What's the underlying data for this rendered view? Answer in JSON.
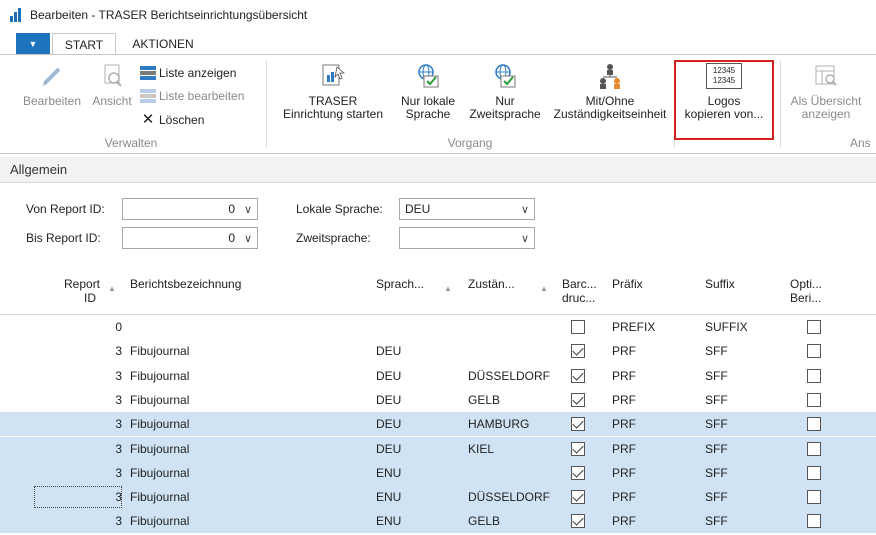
{
  "window": {
    "title": "Bearbeiten - TRASER Berichtseinrichtungsübersicht"
  },
  "tabs": [
    {
      "label": "START"
    },
    {
      "label": "AKTIONEN"
    }
  ],
  "ribbon": {
    "groups": {
      "verwalten": "Verwalten",
      "vorgang": "Vorgang",
      "ansicht": "Ans"
    },
    "buttons": {
      "bearbeiten": "Bearbeiten",
      "ansicht": "Ansicht",
      "liste_anzeigen": "Liste anzeigen",
      "liste_bearbeiten": "Liste bearbeiten",
      "loeschen": "Löschen",
      "traser_line1": "TRASER",
      "traser_line2": "Einrichtung starten",
      "nur_lokale_line1": "Nur lokale",
      "nur_lokale_line2": "Sprache",
      "nur_zweit_line1": "Nur",
      "nur_zweit_line2": "Zweitsprache",
      "mit_ohne_line1": "Mit/Ohne",
      "mit_ohne_line2": "Zuständigkeitseinheit",
      "logos_line1": "Logos",
      "logos_line2": "kopieren von...",
      "logos_icon_text1": "12345",
      "logos_icon_text2": "12345",
      "als_line1": "Als Übersicht",
      "als_line2": "anzeigen"
    }
  },
  "section": {
    "title": "Allgemein"
  },
  "filters": {
    "von_report": {
      "label": "Von Report ID:",
      "value": "0"
    },
    "bis_report": {
      "label": "Bis Report ID:",
      "value": "0"
    },
    "lokale_sprache": {
      "label": "Lokale Sprache:",
      "value": "DEU"
    },
    "zweitsprache": {
      "label": "Zweitsprache:",
      "value": ""
    }
  },
  "table": {
    "columns": {
      "report_id_1": "Report",
      "report_id_2": "ID",
      "bezeichnung": "Berichtsbezeichnung",
      "sprache": "Sprach...",
      "zustaendig": "Zustän...",
      "barcode_1": "Barc...",
      "barcode_2": "druc...",
      "praefix": "Präfix",
      "suffix": "Suffix",
      "opt_1": "Opti...",
      "opt_2": "Beri..."
    },
    "rows": [
      {
        "id": "0",
        "name": "",
        "lang": "",
        "unit": "",
        "barcode": false,
        "prefix": "PREFIX",
        "suffix": "SUFFIX",
        "opt": false
      },
      {
        "id": "3",
        "name": "Fibujournal",
        "lang": "DEU",
        "unit": "",
        "barcode": true,
        "prefix": "PRF",
        "suffix": "SFF",
        "opt": false
      },
      {
        "id": "3",
        "name": "Fibujournal",
        "lang": "DEU",
        "unit": "DÜSSELDORF",
        "barcode": true,
        "prefix": "PRF",
        "suffix": "SFF",
        "opt": false
      },
      {
        "id": "3",
        "name": "Fibujournal",
        "lang": "DEU",
        "unit": "GELB",
        "barcode": true,
        "prefix": "PRF",
        "suffix": "SFF",
        "opt": false
      },
      {
        "id": "3",
        "name": "Fibujournal",
        "lang": "DEU",
        "unit": "HAMBURG",
        "barcode": true,
        "prefix": "PRF",
        "suffix": "SFF",
        "opt": false
      },
      {
        "id": "3",
        "name": "Fibujournal",
        "lang": "DEU",
        "unit": "KIEL",
        "barcode": true,
        "prefix": "PRF",
        "suffix": "SFF",
        "opt": false
      },
      {
        "id": "3",
        "name": "Fibujournal",
        "lang": "ENU",
        "unit": "",
        "barcode": true,
        "prefix": "PRF",
        "suffix": "SFF",
        "opt": false
      },
      {
        "id": "3",
        "name": "Fibujournal",
        "lang": "ENU",
        "unit": "DÜSSELDORF",
        "barcode": true,
        "prefix": "PRF",
        "suffix": "SFF",
        "opt": false
      },
      {
        "id": "3",
        "name": "Fibujournal",
        "lang": "ENU",
        "unit": "GELB",
        "barcode": true,
        "prefix": "PRF",
        "suffix": "SFF",
        "opt": false
      }
    ]
  },
  "colors": {
    "accent": "#1e73be",
    "selection": "#cfe3f4",
    "highlight": "#d9201e"
  }
}
